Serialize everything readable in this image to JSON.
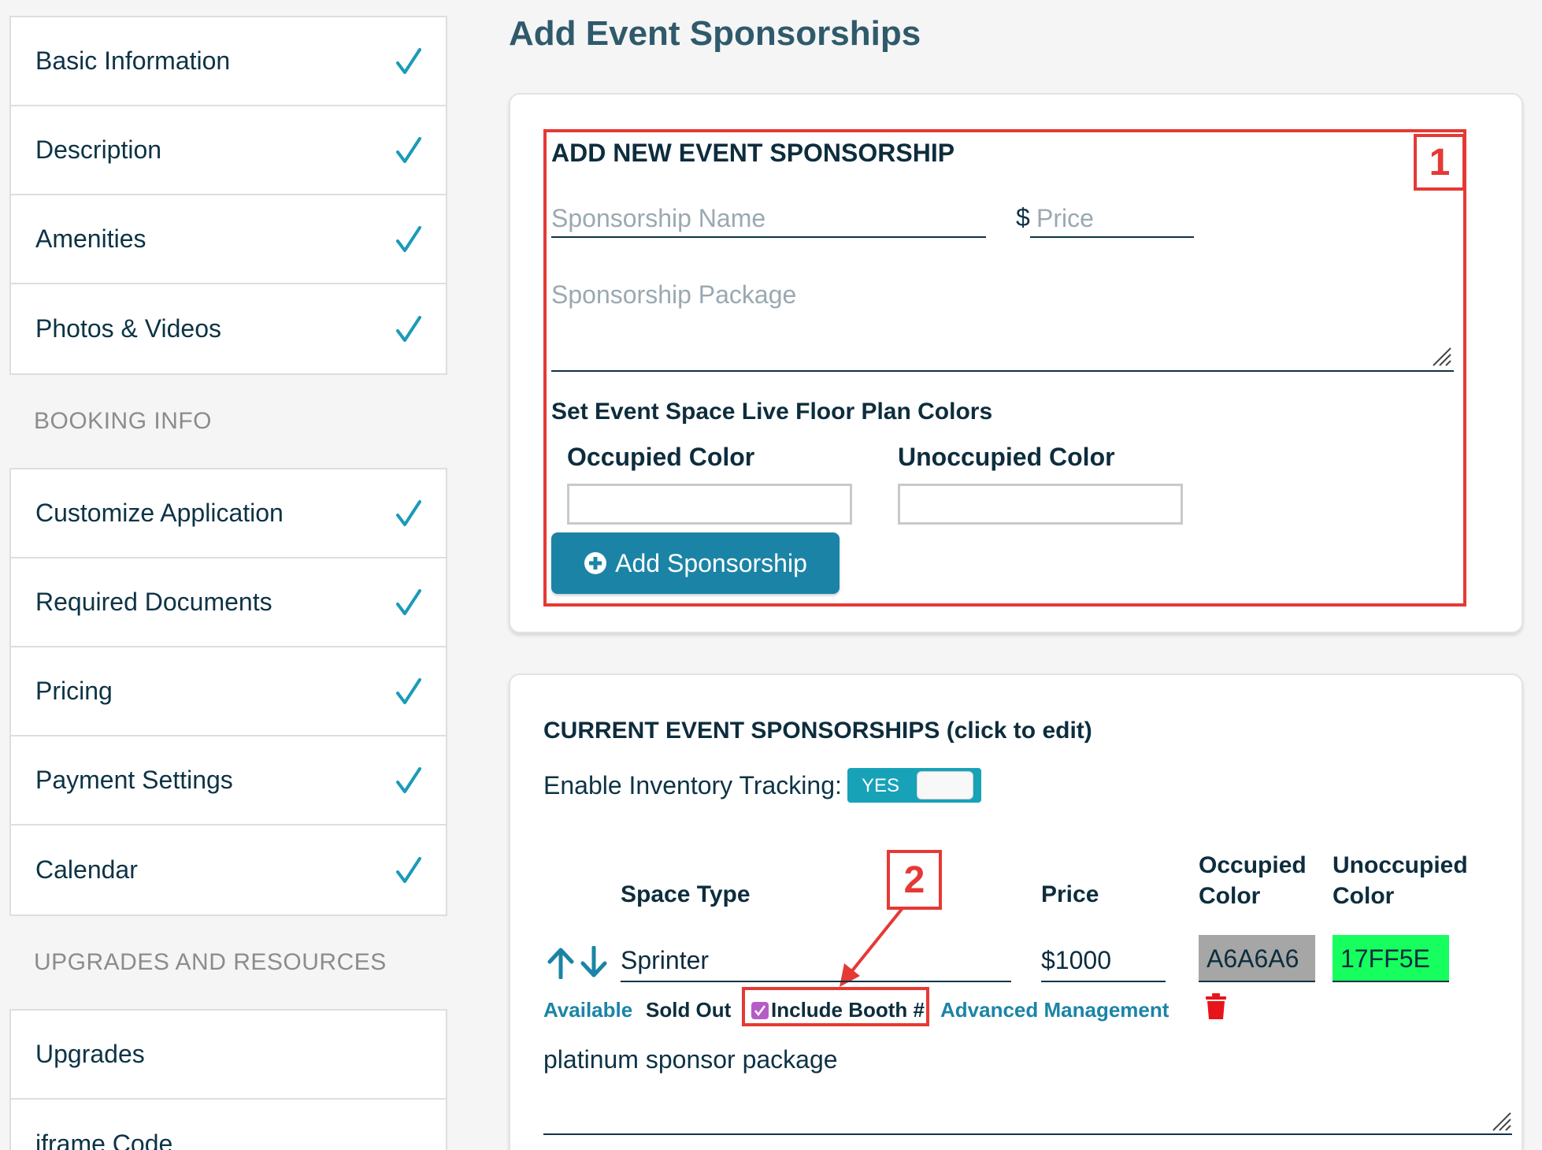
{
  "sidebar": {
    "group1": [
      "Basic Information",
      "Description",
      "Amenities",
      "Photos & Videos"
    ],
    "booking_label": "BOOKING INFO",
    "group2": [
      "Customize Application",
      "Required Documents",
      "Pricing",
      "Payment Settings",
      "Calendar"
    ],
    "upgrades_label": "UPGRADES AND RESOURCES",
    "group3": [
      "Upgrades",
      "iframe Code"
    ],
    "check_color": "#1b9ab8"
  },
  "page": {
    "title": "Add Event Sponsorships"
  },
  "add_form": {
    "heading": "ADD NEW EVENT SPONSORSHIP",
    "badge": "1",
    "name_placeholder": "Sponsorship Name",
    "currency": "$",
    "price_placeholder": "Price",
    "package_placeholder": "Sponsorship Package",
    "colors_heading": "Set Event Space Live Floor Plan Colors",
    "occupied_label": "Occupied Color",
    "unoccupied_label": "Unoccupied Color",
    "add_button_label": "Add Sponsorship"
  },
  "current": {
    "heading": "CURRENT EVENT SPONSORSHIPS (click to edit)",
    "inventory_label": "Enable Inventory Tracking:",
    "toggle_label": "YES",
    "badge": "2",
    "col_space_type": "Space Type",
    "col_price": "Price",
    "col_occupied_1": "Occupied",
    "col_occupied_2": "Color",
    "col_unoccupied_1": "Unoccupied",
    "col_unoccupied_2": "Color",
    "row": {
      "space_type": "Sprinter",
      "price": "$1000",
      "occupied_color": "A6A6A6",
      "occupied_color_hex": "#A6A6A6",
      "unoccupied_color": "17FF5E",
      "unoccupied_color_hex": "#17FF5E",
      "available_label": "Available",
      "sold_out_label": "Sold Out",
      "include_booth_label": "Include Booth #",
      "include_booth_checked": true,
      "advanced_label": "Advanced Management",
      "package_text": "platinum sponsor package"
    }
  }
}
